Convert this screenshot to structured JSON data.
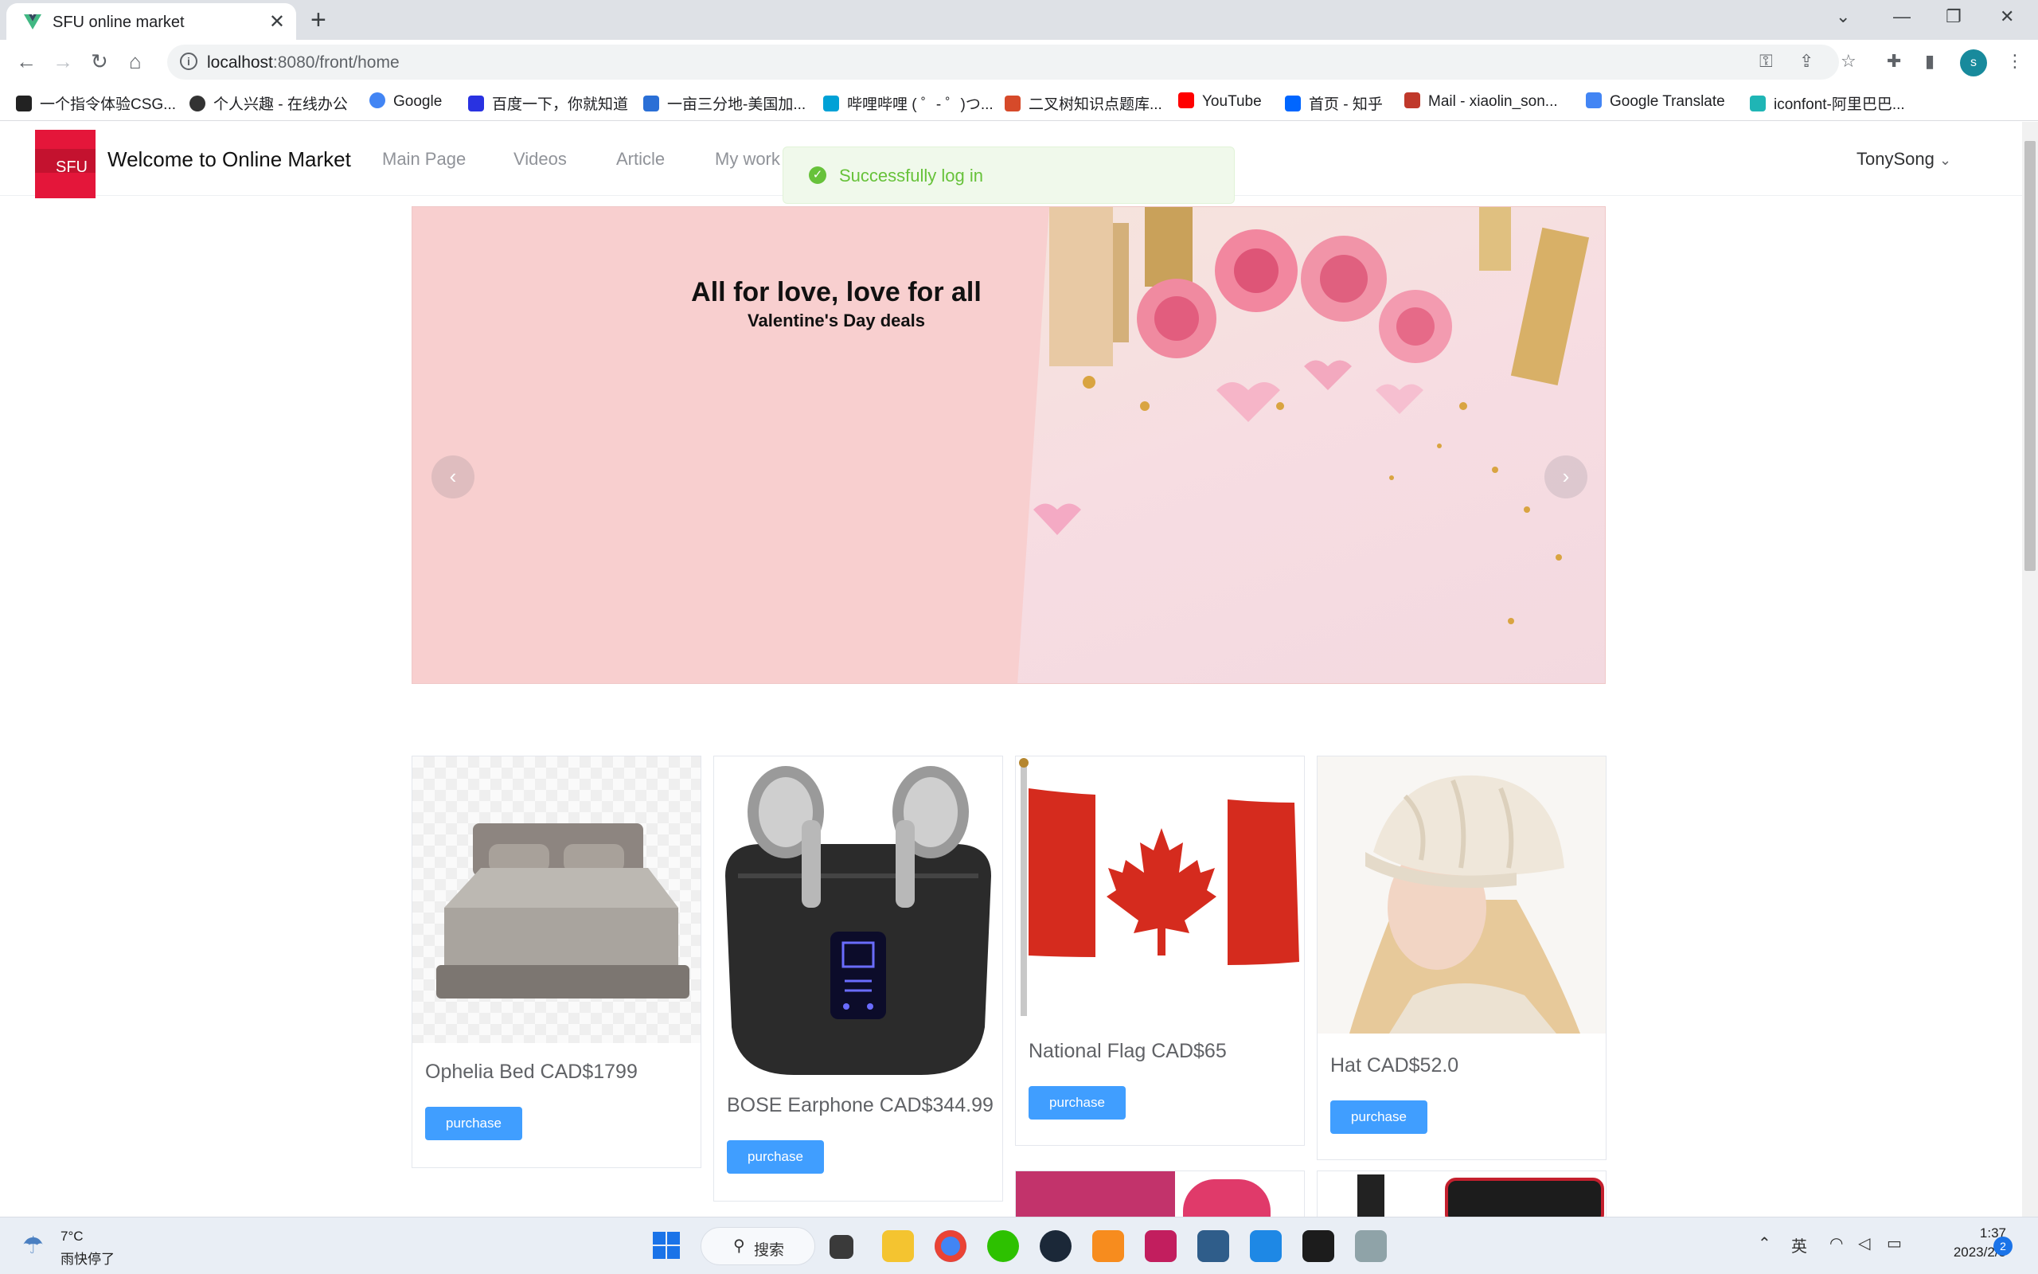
{
  "browser": {
    "tab_title": "SFU online market",
    "url_host": "localhost",
    "url_rest": ":8080/front/home",
    "profile_initial": "s",
    "bookmarks": [
      {
        "label": "一个指令体验CSG...",
        "color": "#222222"
      },
      {
        "label": "个人兴趣 - 在线办公",
        "color": "#333333"
      },
      {
        "label": "Google",
        "color": "#4285f4"
      },
      {
        "label": "百度一下，你就知道",
        "color": "#2932e1"
      },
      {
        "label": "一亩三分地-美国加...",
        "color": "#2a6fd6"
      },
      {
        "label": "哔哩哔哩 ( ゜- ゜)つ...",
        "color": "#00a1d6"
      },
      {
        "label": "二叉树知识点题库...",
        "color": "#d64a2a"
      },
      {
        "label": "YouTube",
        "color": "#ff0000"
      },
      {
        "label": "首页 - 知乎",
        "color": "#0066ff"
      },
      {
        "label": "Mail - xiaolin_son...",
        "color": "#c0392b"
      },
      {
        "label": "Google Translate",
        "color": "#4285f4"
      },
      {
        "label": "iconfont-阿里巴巴...",
        "color": "#1fb5b5"
      }
    ]
  },
  "site": {
    "logo_text": "SFU",
    "title": "Welcome to Online Market",
    "nav": [
      "Main Page",
      "Videos",
      "Article",
      "My work"
    ],
    "user": "TonySong"
  },
  "toast": {
    "message": "Successfully log in",
    "color": "#67c23a"
  },
  "carousel": {
    "heading": "All for love, love for all",
    "subheading": "Valentine's Day deals",
    "prev_icon": "chevron-left-icon",
    "next_icon": "chevron-right-icon"
  },
  "products": [
    {
      "name": "Ophelia Bed CAD$1799",
      "button": "purchase",
      "image": "bed"
    },
    {
      "name": "BOSE Earphone CAD$344.99",
      "button": "purchase",
      "image": "earbuds"
    },
    {
      "name": "National Flag CAD$65",
      "button": "purchase",
      "image": "canada-flag"
    },
    {
      "name": "Hat CAD$52.0",
      "button": "purchase",
      "image": "knit-hat"
    }
  ],
  "taskbar": {
    "weather_temp": "7°C",
    "weather_desc": "雨快停了",
    "search_label": "搜索",
    "time": "1:37",
    "date": "2023/2/5",
    "ime": "英",
    "notification_count": "2"
  },
  "accent_color": "#409eff"
}
